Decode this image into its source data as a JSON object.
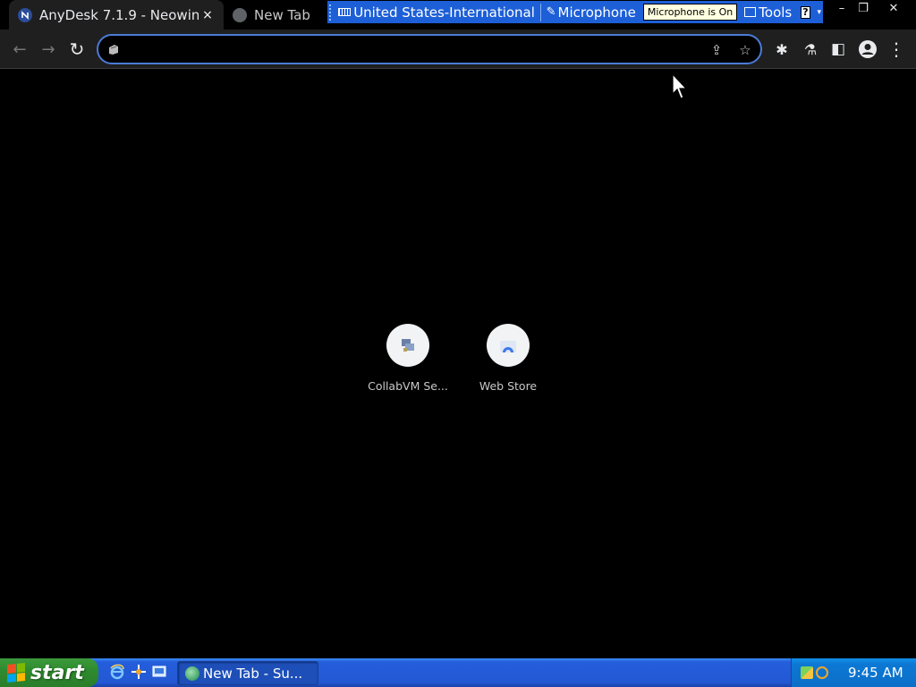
{
  "browser": {
    "tabs": [
      {
        "title": "AnyDesk 7.1.9 - Neowin",
        "close": "×",
        "active": true
      },
      {
        "title": "New Tab",
        "active": false
      }
    ],
    "window_controls": {
      "minimize": "–",
      "restore": "❐",
      "close": "✕"
    },
    "toolbar": {
      "back": "←",
      "forward": "→",
      "reload": "↻",
      "omnibox_value": "",
      "share": "⇪",
      "bookmark": "☆",
      "extensions": "✱",
      "labs": "⚗",
      "sidepanel": "◧",
      "menu": "⋮"
    }
  },
  "language_bar": {
    "keyboard_label": "United States-International",
    "microphone_label": "Microphone",
    "microphone_tooltip": "Microphone is On",
    "tools_label": "Tools",
    "help": "?",
    "options_arrow": "▾"
  },
  "shortcuts": [
    {
      "label": "CollabVM Se..."
    },
    {
      "label": "Web Store"
    }
  ],
  "taskbar": {
    "start_label": "start",
    "task_button": "New Tab - Su...",
    "clock": "9:45 AM"
  },
  "colors": {
    "accent": "#4b7bd8",
    "taskbar_blue": "#245edb",
    "start_green": "#2f8b2f"
  }
}
